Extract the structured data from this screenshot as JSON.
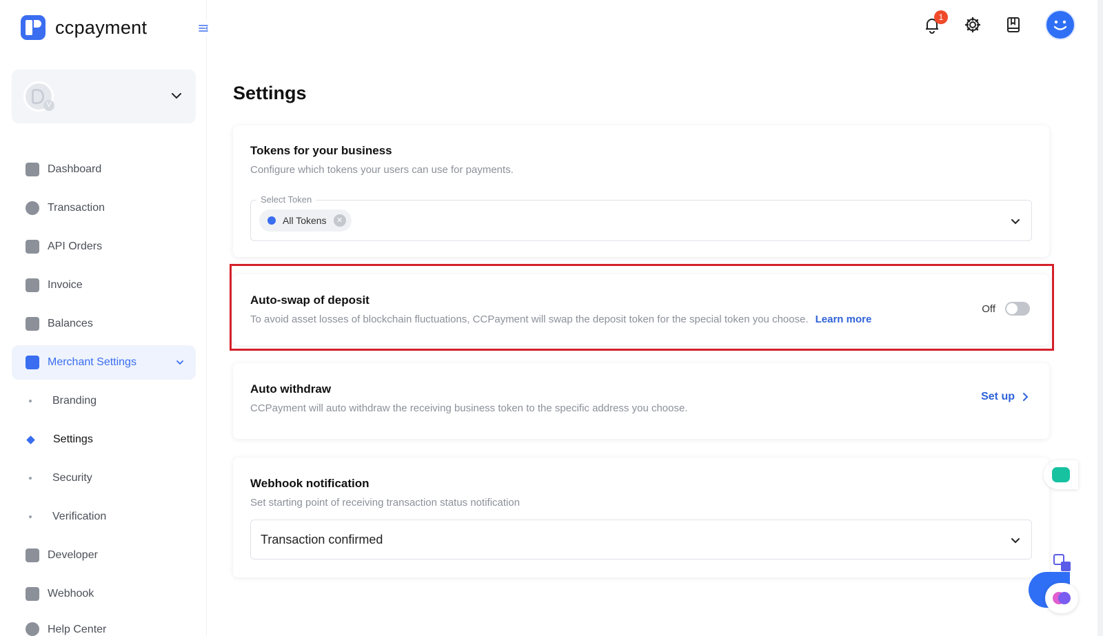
{
  "brand": {
    "name": "ccpayment"
  },
  "header": {
    "notification_count": "1"
  },
  "sidebar": {
    "merchant_badge": "V",
    "items": [
      {
        "label": "Dashboard",
        "icon": "dashboard-icon"
      },
      {
        "label": "Transaction",
        "icon": "transaction-icon"
      },
      {
        "label": "API Orders",
        "icon": "api-orders-icon"
      },
      {
        "label": "Invoice",
        "icon": "invoice-icon"
      },
      {
        "label": "Balances",
        "icon": "balances-icon"
      },
      {
        "label": "Merchant Settings",
        "icon": "merchant-settings-icon",
        "active": true
      }
    ],
    "subitems": [
      {
        "label": "Branding"
      },
      {
        "label": "Settings",
        "active": true
      },
      {
        "label": "Security"
      },
      {
        "label": "Verification"
      }
    ],
    "items_after": [
      {
        "label": "Developer",
        "icon": "developer-icon"
      },
      {
        "label": "Webhook",
        "icon": "webhook-icon"
      },
      {
        "label": "Help Center",
        "icon": "help-center-icon"
      }
    ]
  },
  "page": {
    "title": "Settings"
  },
  "tokens_card": {
    "title": "Tokens for your business",
    "description": "Configure which tokens your users can use for payments.",
    "select_label": "Select Token",
    "chip_label": "All Tokens"
  },
  "autoswap_card": {
    "title": "Auto-swap of deposit",
    "description": "To avoid asset losses of blockchain fluctuations, CCPayment will swap the deposit token for the special token you choose.",
    "learn_more": "Learn more",
    "toggle_label": "Off",
    "toggle_on": false
  },
  "withdraw_card": {
    "title": "Auto withdraw",
    "description": "CCPayment will auto withdraw the receiving business token to the specific address you choose.",
    "action": "Set up"
  },
  "webhook_card": {
    "title": "Webhook notification",
    "description": "Set starting point of receiving transaction status notification",
    "selected": "Transaction confirmed"
  },
  "colors": {
    "accent": "#3a6df0",
    "link": "#2e62d9",
    "highlight": "#d4202b",
    "badge": "#f04a2a"
  }
}
